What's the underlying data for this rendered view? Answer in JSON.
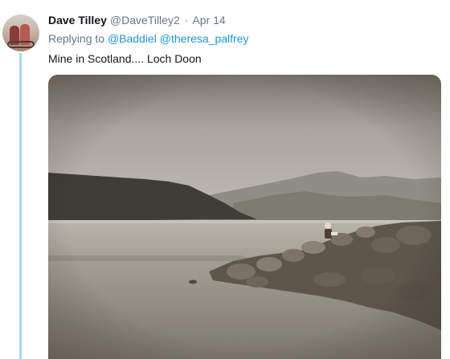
{
  "tweet": {
    "author_name": "Dave Tilley",
    "handle": "@DaveTilley2",
    "separator": "·",
    "date": "Apr 14",
    "replying_prefix": "Replying to",
    "mentions": [
      "@Baddiel",
      "@theresa_palfrey"
    ],
    "text": "Mine in Scotland.... Loch Doon"
  },
  "colors": {
    "link": "#1b95e0",
    "thread_line": "#a9d6f4",
    "muted": "#657786"
  },
  "icons": {
    "avatar": "profile-photo",
    "photo": "loch-photo"
  }
}
